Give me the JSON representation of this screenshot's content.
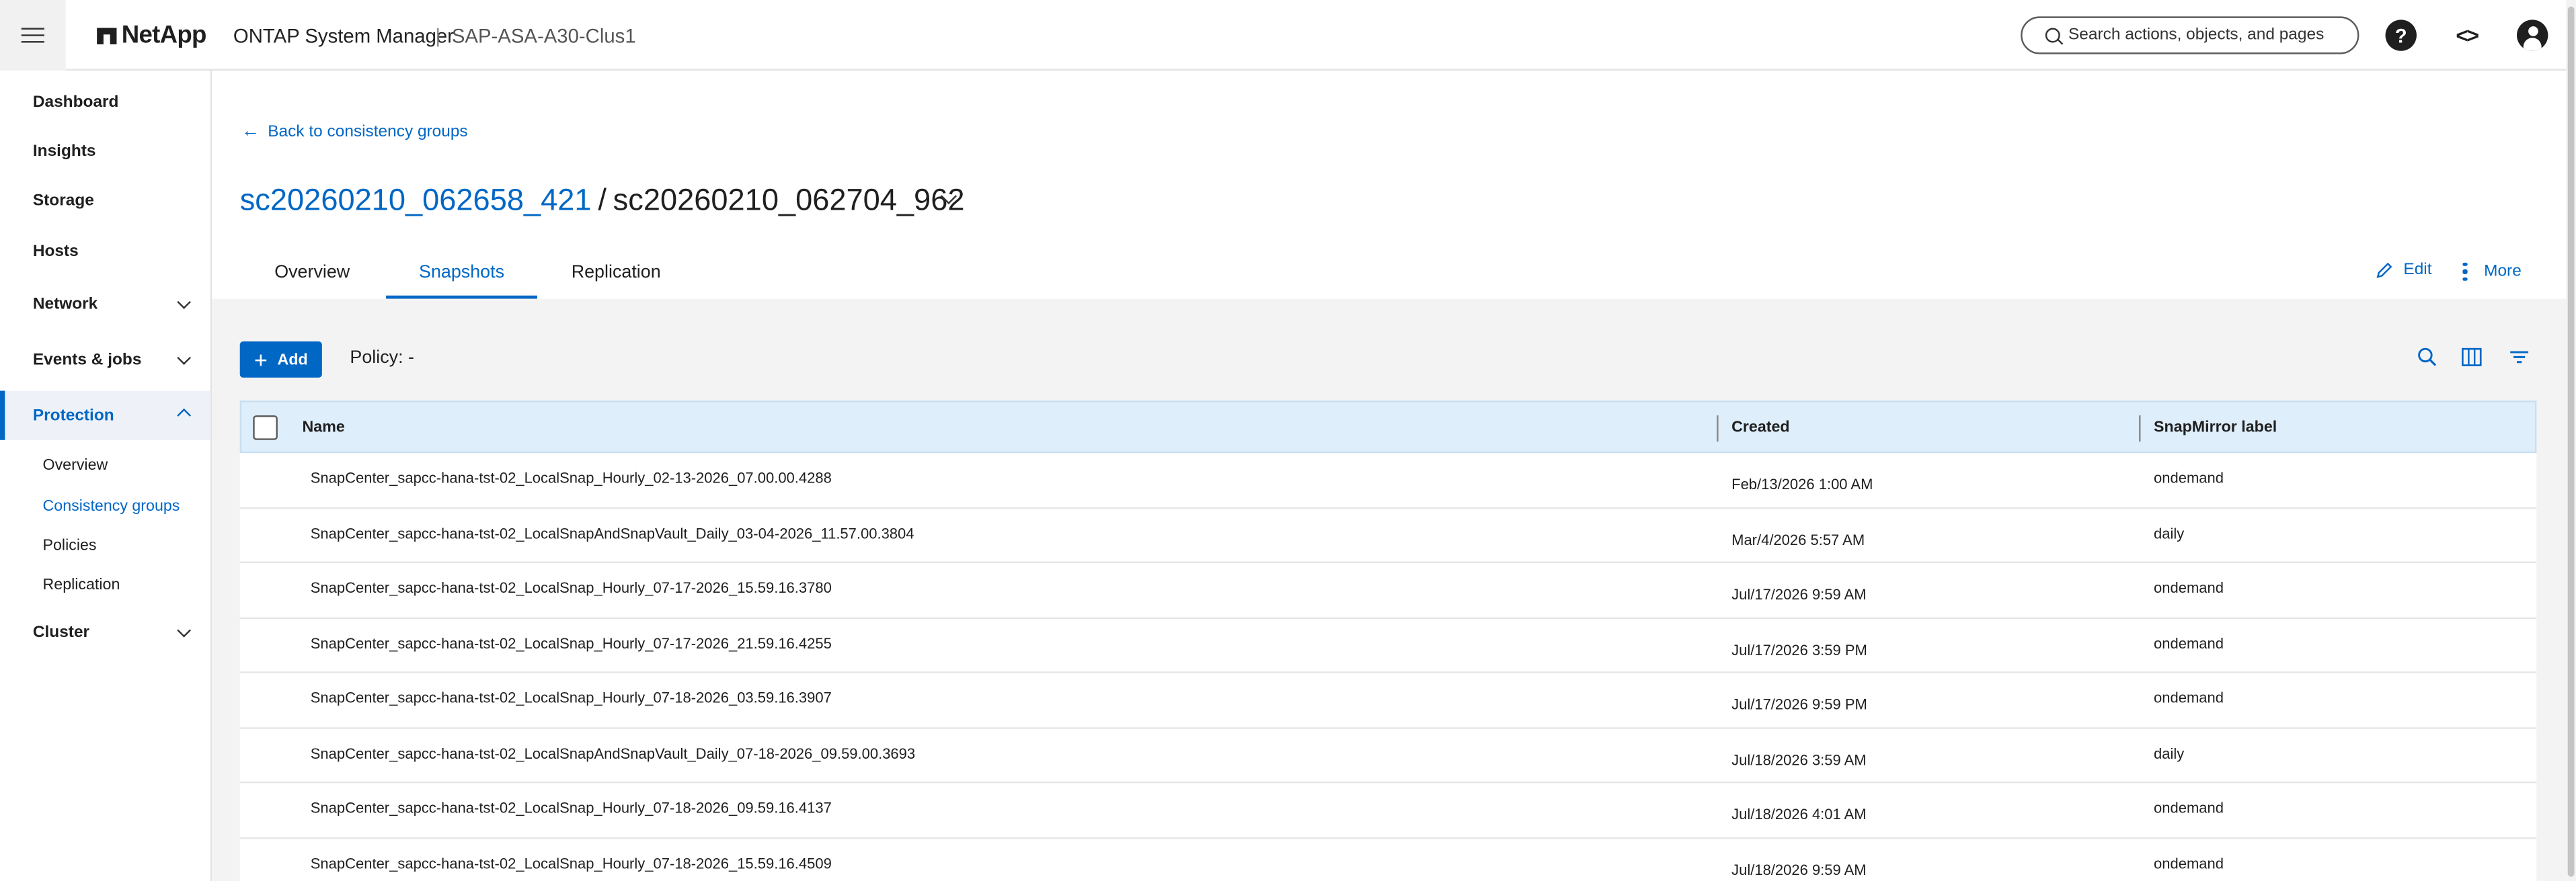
{
  "header": {
    "brand": "NetApp",
    "product": "ONTAP System Manager",
    "separator": "|",
    "cluster_name": "SAP-ASA-A30-Clus1",
    "search_placeholder": "Search actions, objects, and pages",
    "help_glyph": "?",
    "code_glyph": "<>"
  },
  "sidebar": {
    "items": [
      {
        "label": "Dashboard"
      },
      {
        "label": "Insights"
      },
      {
        "label": "Storage"
      },
      {
        "label": "Hosts"
      },
      {
        "label": "Network"
      },
      {
        "label": "Events & jobs"
      },
      {
        "label": "Protection"
      },
      {
        "label": "Cluster"
      }
    ],
    "protection_sub": [
      {
        "label": "Overview"
      },
      {
        "label": "Consistency groups"
      },
      {
        "label": "Policies"
      },
      {
        "label": "Replication"
      }
    ]
  },
  "page": {
    "back_link": "Back to consistency groups",
    "parent_group": "sc20260210_062658_421",
    "title_separator": "/",
    "child_group": "sc20260210_062704_962",
    "tabs": [
      {
        "label": "Overview"
      },
      {
        "label": "Snapshots"
      },
      {
        "label": "Replication"
      }
    ],
    "edit_label": "Edit",
    "more_label": "More"
  },
  "toolbar": {
    "add_label": "Add",
    "policy_text": "Policy: -"
  },
  "table": {
    "columns": {
      "name": "Name",
      "created": "Created",
      "label": "SnapMirror label"
    },
    "rows": [
      {
        "name": "SnapCenter_sapcc-hana-tst-02_LocalSnap_Hourly_02-13-2026_07.00.00.4288",
        "created": "Feb/13/2026 1:00 AM",
        "label": "ondemand"
      },
      {
        "name": "SnapCenter_sapcc-hana-tst-02_LocalSnapAndSnapVault_Daily_03-04-2026_11.57.00.3804",
        "created": "Mar/4/2026 5:57 AM",
        "label": "daily"
      },
      {
        "name": "SnapCenter_sapcc-hana-tst-02_LocalSnap_Hourly_07-17-2026_15.59.16.3780",
        "created": "Jul/17/2026 9:59 AM",
        "label": "ondemand"
      },
      {
        "name": "SnapCenter_sapcc-hana-tst-02_LocalSnap_Hourly_07-17-2026_21.59.16.4255",
        "created": "Jul/17/2026 3:59 PM",
        "label": "ondemand"
      },
      {
        "name": "SnapCenter_sapcc-hana-tst-02_LocalSnap_Hourly_07-18-2026_03.59.16.3907",
        "created": "Jul/17/2026 9:59 PM",
        "label": "ondemand"
      },
      {
        "name": "SnapCenter_sapcc-hana-tst-02_LocalSnapAndSnapVault_Daily_07-18-2026_09.59.00.3693",
        "created": "Jul/18/2026 3:59 AM",
        "label": "daily"
      },
      {
        "name": "SnapCenter_sapcc-hana-tst-02_LocalSnap_Hourly_07-18-2026_09.59.16.4137",
        "created": "Jul/18/2026 4:01 AM",
        "label": "ondemand"
      },
      {
        "name": "SnapCenter_sapcc-hana-tst-02_LocalSnap_Hourly_07-18-2026_15.59.16.4509",
        "created": "Jul/18/2026 9:59 AM",
        "label": "ondemand"
      }
    ]
  },
  "colors": {
    "accent": "#0067c5",
    "header_row": "#deeefa",
    "content_bg": "#f3f3f3"
  },
  "icons": {
    "menu": "hamburger-icon",
    "brand": "netapp-logo-icon",
    "search": "search-icon",
    "help": "help-icon",
    "code": "code-icon",
    "user": "user-icon",
    "back": "arrow-left-icon",
    "edit": "pencil-icon",
    "more": "kebab-icon",
    "add": "plus-icon",
    "table_search": "search-icon",
    "columns": "columns-icon",
    "filter": "filter-icon"
  }
}
